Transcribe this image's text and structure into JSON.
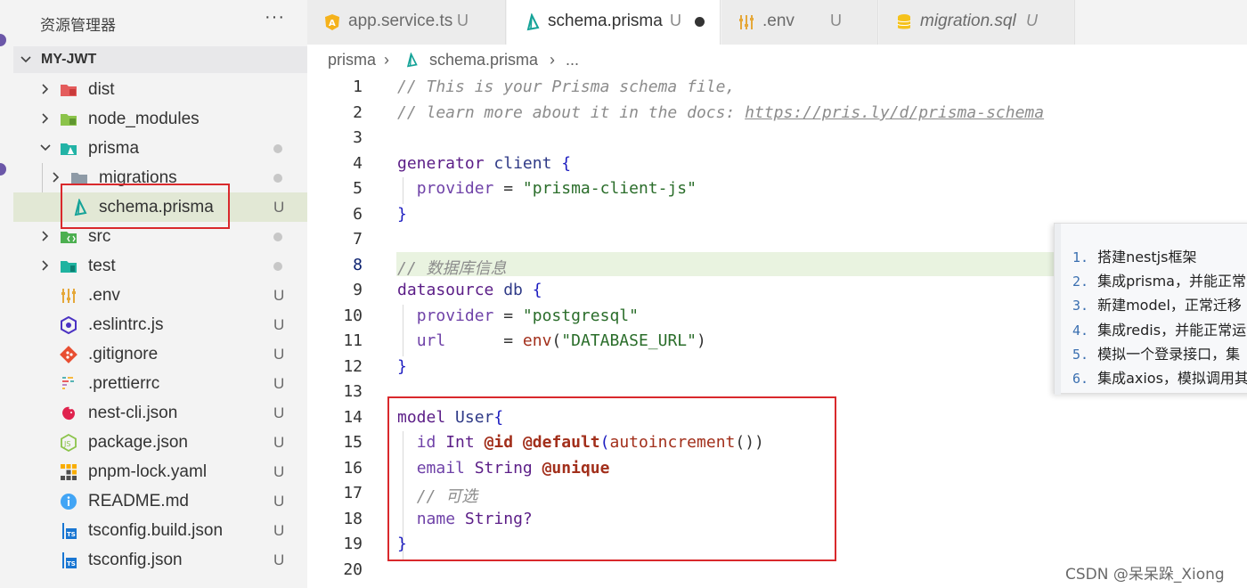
{
  "sidebar": {
    "title": "资源管理器",
    "more": "···",
    "root": "MY-JWT",
    "items": [
      {
        "label": "dist",
        "badge": ""
      },
      {
        "label": "node_modules",
        "badge": ""
      },
      {
        "label": "prisma",
        "badge": ""
      },
      {
        "label": "migrations",
        "badge": ""
      },
      {
        "label": "schema.prisma",
        "badge": "U"
      },
      {
        "label": "src",
        "badge": ""
      },
      {
        "label": "test",
        "badge": ""
      },
      {
        "label": ".env",
        "badge": "U"
      },
      {
        "label": ".eslintrc.js",
        "badge": "U"
      },
      {
        "label": ".gitignore",
        "badge": "U"
      },
      {
        "label": ".prettierrc",
        "badge": "U"
      },
      {
        "label": "nest-cli.json",
        "badge": "U"
      },
      {
        "label": "package.json",
        "badge": "U"
      },
      {
        "label": "pnpm-lock.yaml",
        "badge": "U"
      },
      {
        "label": "README.md",
        "badge": "U"
      },
      {
        "label": "tsconfig.build.json",
        "badge": "U"
      },
      {
        "label": "tsconfig.json",
        "badge": "U"
      }
    ]
  },
  "tabs": [
    {
      "label": "app.service.ts",
      "status": "U"
    },
    {
      "label": "schema.prisma",
      "status": "U"
    },
    {
      "label": ".env",
      "status": "U"
    },
    {
      "label": "migration.sql",
      "status": "U"
    }
  ],
  "breadcrumb": {
    "folder": "prisma",
    "sep": "›",
    "file": "schema.prisma",
    "tail": "..."
  },
  "editor": {
    "line_numbers": [
      "1",
      "2",
      "3",
      "4",
      "5",
      "6",
      "7",
      "8",
      "9",
      "10",
      "11",
      "12",
      "13",
      "14",
      "15",
      "16",
      "17",
      "18",
      "19",
      "20"
    ],
    "code": {
      "l1": "// This is your Prisma schema file,",
      "l2a": "// learn more about it in the docs: ",
      "l2b": "https://pris.ly/d/prisma-schema",
      "generator": "generator",
      "client": "client",
      "provider": "provider",
      "eq": " = ",
      "prisma_client_js": "\"prisma-client-js\"",
      "l8": "// 数据库信息",
      "datasource": "datasource",
      "db": "db",
      "postgresql": "\"postgresql\"",
      "url": "url",
      "url_eq": "      = ",
      "env": "env",
      "database_url": "\"DATABASE_URL\"",
      "model": "model",
      "user": "User",
      "id": "id",
      "int": "Int",
      "at_id": "@id",
      "at_default": "@default",
      "autoincrement": "autoincrement",
      "email": "email",
      "string": "String",
      "at_unique": "@unique",
      "l17": "// 可选",
      "name": "name",
      "string_opt": "String?"
    }
  },
  "popup": {
    "items": [
      {
        "num": "1.",
        "text": "搭建nestjs框架"
      },
      {
        "num": "2.",
        "text": "集成prisma，并能正常"
      },
      {
        "num": "3.",
        "text": "新建model，正常迁移"
      },
      {
        "num": "4.",
        "text": "集成redis，并能正常运"
      },
      {
        "num": "5.",
        "text": "模拟一个登录接口，集"
      },
      {
        "num": "6.",
        "text": "集成axios，模拟调用其"
      }
    ]
  },
  "watermark": "CSDN @呆呆跺_Xiong",
  "colors": {
    "accent_red": "#d9292c",
    "prisma_teal": "#15a398",
    "selection": "#e2e8d5"
  }
}
